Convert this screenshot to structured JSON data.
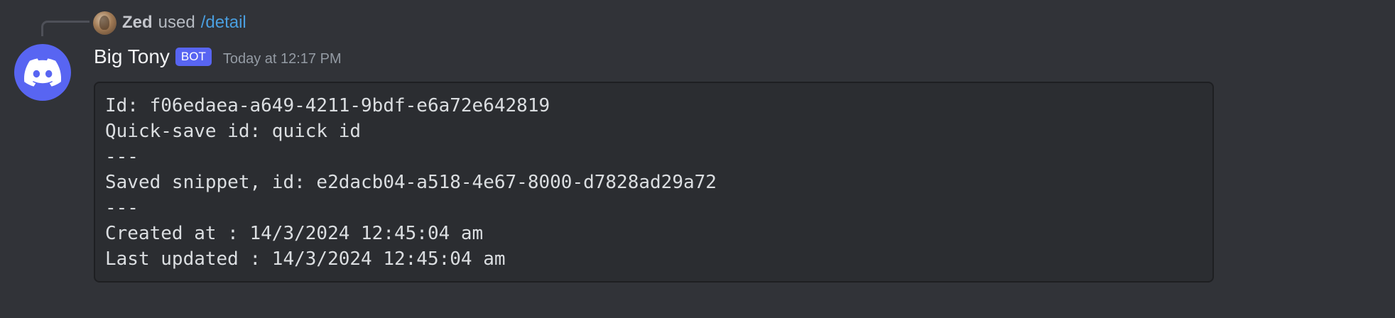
{
  "reply": {
    "user": "Zed",
    "verb": "used",
    "command": "/detail"
  },
  "message": {
    "author": "Big Tony",
    "badge": "BOT",
    "timestamp": "Today at 12:17 PM",
    "code_lines": [
      "Id: f06edaea-a649-4211-9bdf-e6a72e642819",
      "Quick-save id: quick id",
      "---",
      "Saved snippet, id: e2dacb04-a518-4e67-8000-d7828ad29a72",
      "---",
      "Created at : 14/3/2024 12:45:04 am",
      "Last updated : 14/3/2024 12:45:04 am"
    ]
  },
  "colors": {
    "background": "#313338",
    "blurple": "#5865f2",
    "command_link": "#4a9fe0",
    "codeblock_bg": "#2b2d31"
  },
  "icons": {
    "avatar": "discord-logo-icon",
    "reply_avatar": "user-avatar"
  }
}
